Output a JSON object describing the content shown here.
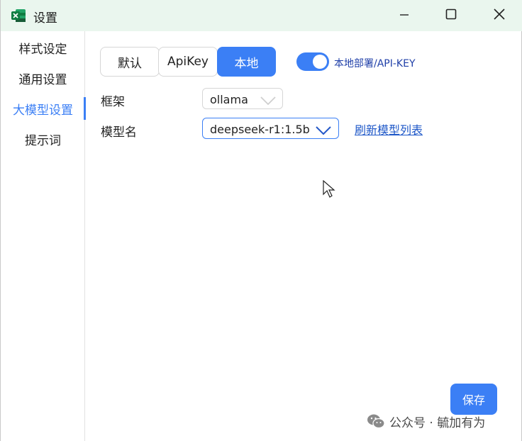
{
  "window": {
    "title": "设置",
    "app_icon": "excel-icon"
  },
  "titlebar_buttons": {
    "minimize": "minimize-icon",
    "maximize": "maximize-icon",
    "close": "close-icon"
  },
  "sidebar": {
    "items": [
      {
        "label": "样式设定",
        "active": false
      },
      {
        "label": "通用设置",
        "active": false
      },
      {
        "label": "大模型设置",
        "active": true
      },
      {
        "label": "提示词",
        "active": false
      }
    ]
  },
  "mode_tabs": [
    {
      "label": "默认",
      "active": false
    },
    {
      "label": "ApiKey",
      "active": false
    },
    {
      "label": "本地",
      "active": true
    }
  ],
  "toggle": {
    "label": "本地部署/API-KEY",
    "on": true
  },
  "form": {
    "framework": {
      "label": "框架",
      "value": "ollama"
    },
    "model_name": {
      "label": "模型名",
      "value": "deepseek-r1:1.5b"
    },
    "refresh_link": "刷新模型列表"
  },
  "save_button": "保存",
  "watermark": {
    "text": "公众号 · 毓加有为",
    "icon": "wechat-icon"
  },
  "colors": {
    "accent": "#3b7ff5",
    "titlebar_bg": "#eaf6ee",
    "link": "#1f58c8"
  }
}
